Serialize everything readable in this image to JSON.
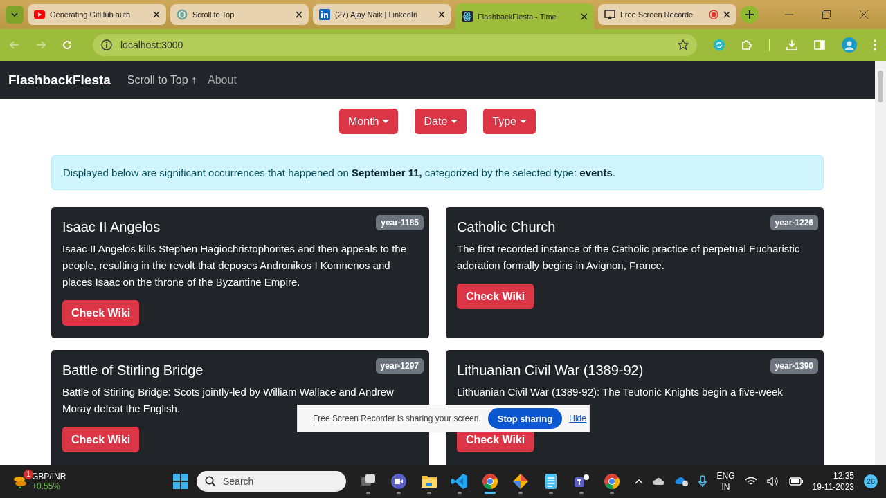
{
  "browser": {
    "tabs": [
      {
        "title": "Generating GitHub auth",
        "selected": false
      },
      {
        "title": "Scroll to Top",
        "selected": false
      },
      {
        "title": "(27) Ajay Naik | LinkedIn",
        "selected": false
      },
      {
        "title": "FlashbackFiesta - Time",
        "selected": true
      },
      {
        "title": "Free Screen Recorde",
        "selected": false,
        "recording": true
      }
    ],
    "address": "localhost:3000"
  },
  "navbar": {
    "brand": "FlashbackFiesta",
    "links": [
      {
        "label": "Scroll to Top ↑"
      },
      {
        "label": "About"
      }
    ]
  },
  "filters": [
    {
      "label": "Month"
    },
    {
      "label": "Date"
    },
    {
      "label": "Type"
    }
  ],
  "alert": "Displayed below are significant occurrences that happened on **September 11,** categorized by the selected type: **events**.",
  "cards": [
    {
      "title": "Isaac II Angelos",
      "year": "year-1185",
      "text": "Isaac II Angelos kills Stephen Hagiochristophorites and then appeals to the people, resulting in the revolt that deposes Andronikos I Komnenos and places Isaac on the throne of the Byzantine Empire.",
      "button": "Check Wiki"
    },
    {
      "title": "Catholic Church",
      "year": "year-1226",
      "text": "The first recorded instance of the Catholic practice of perpetual Eucharistic adoration formally begins in Avignon, France.",
      "button": "Check Wiki"
    },
    {
      "title": "Battle of Stirling Bridge",
      "year": "year-1297",
      "text": "Battle of Stirling Bridge: Scots jointly-led by William Wallace and Andrew Moray defeat the English.",
      "button": "Check Wiki"
    },
    {
      "title": "Lithuanian Civil War (1389-92)",
      "year": "year-1390",
      "text": "Lithuanian Civil War (1389-92): The Teutonic Knights begin a five-week",
      "button": "Check Wiki"
    }
  ],
  "share_bar": {
    "message": "Free Screen Recorder is sharing your screen.",
    "stop": "Stop sharing",
    "hide": "Hide"
  },
  "taskbar": {
    "widget": {
      "badge": "1",
      "symbol": "GBP/INR",
      "change": "+0.55%"
    },
    "search": {
      "placeholder": "Search"
    },
    "apps": [
      {
        "kind": "taskview",
        "active": false
      },
      {
        "kind": "meet",
        "active": false
      },
      {
        "kind": "files",
        "active": false
      },
      {
        "kind": "code",
        "active": false
      },
      {
        "kind": "chrome",
        "active": true
      },
      {
        "kind": "git",
        "active": false
      },
      {
        "kind": "notepad",
        "active": false
      },
      {
        "kind": "teams",
        "active": false
      },
      {
        "kind": "chrome",
        "active": false
      }
    ],
    "language": [
      "ENG",
      "IN"
    ],
    "time": "12:35",
    "date": "19-11-2023",
    "notifications": "26"
  }
}
